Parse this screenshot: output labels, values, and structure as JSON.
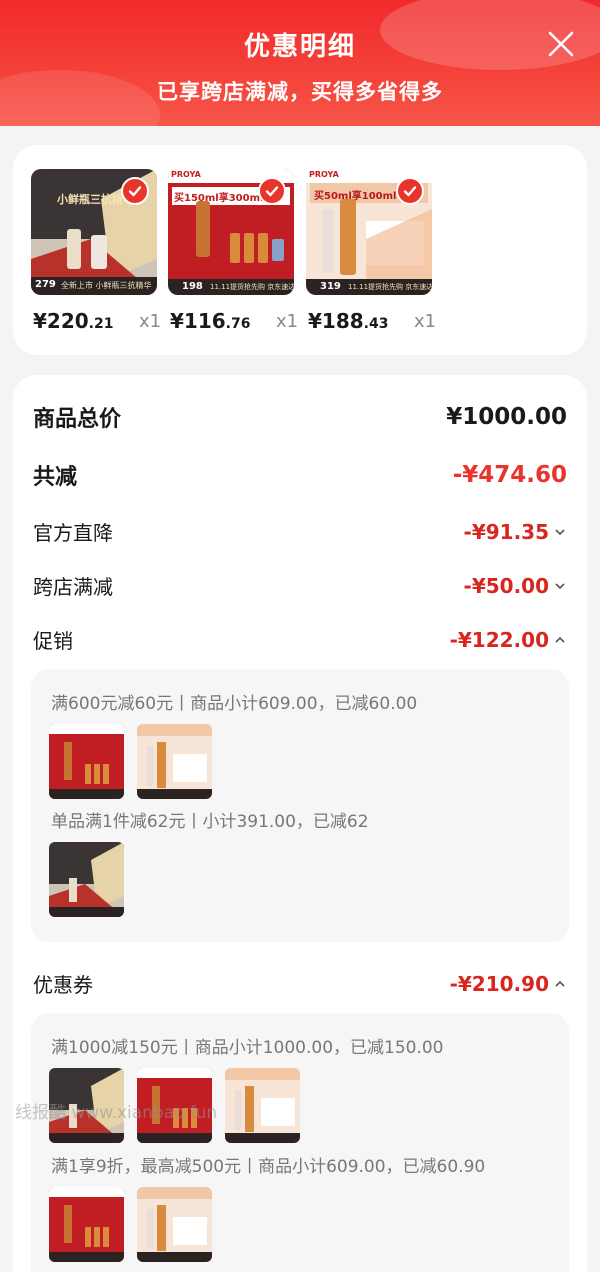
{
  "header": {
    "title": "优惠明细",
    "subtitle": "已享跨店满减，买得多省得多"
  },
  "products": [
    {
      "price_main": "¥220",
      "price_dec": ".21",
      "qty": "x1",
      "thumb_price": "279",
      "thumb_caption": "全新上市 小鲜瓶三抗精华",
      "thumb_headline": "小鲜瓶三抗精华"
    },
    {
      "price_main": "¥116",
      "price_dec": ".76",
      "qty": "x1",
      "thumb_price": "198",
      "thumb_caption": "11.11提货抢先购 京东速达!",
      "thumb_brand": "PROYA",
      "thumb_headline": "买150ml享300ml"
    },
    {
      "price_main": "¥188",
      "price_dec": ".43",
      "qty": "x1",
      "thumb_price": "319",
      "thumb_caption": "11.11提货抢先购 京东速达!",
      "thumb_brand": "PROYA",
      "thumb_headline": "买50ml享100ml"
    }
  ],
  "summary": {
    "total_label": "商品总价",
    "total_value": "¥1000.00",
    "reduce_label": "共减",
    "reduce_value": "-¥474.60",
    "official_label": "官方直降",
    "official_value": "-¥91.35",
    "cross_label": "跨店满减",
    "cross_value": "-¥50.00",
    "promo_label": "促销",
    "promo_value": "-¥122.00",
    "coupon_label": "优惠券",
    "coupon_value": "-¥210.90"
  },
  "promo_details": [
    {
      "text": "满600元减60元丨商品小计609.00，已减60.00"
    },
    {
      "text": "单品满1件减62元丨小计391.00，已减62"
    }
  ],
  "coupon_details": [
    {
      "text": "满1000减150元丨商品小计1000.00，已减150.00"
    },
    {
      "text": "满1享9折，最高减500元丨商品小计609.00，已减60.90"
    }
  ],
  "watermark": "线报酷 www.xianbao.fun",
  "colors": {
    "accent": "#e8342a",
    "header": "#f12a2c"
  },
  "icons": [
    "close-icon",
    "check-icon",
    "chevron-down-icon",
    "chevron-up-icon"
  ]
}
